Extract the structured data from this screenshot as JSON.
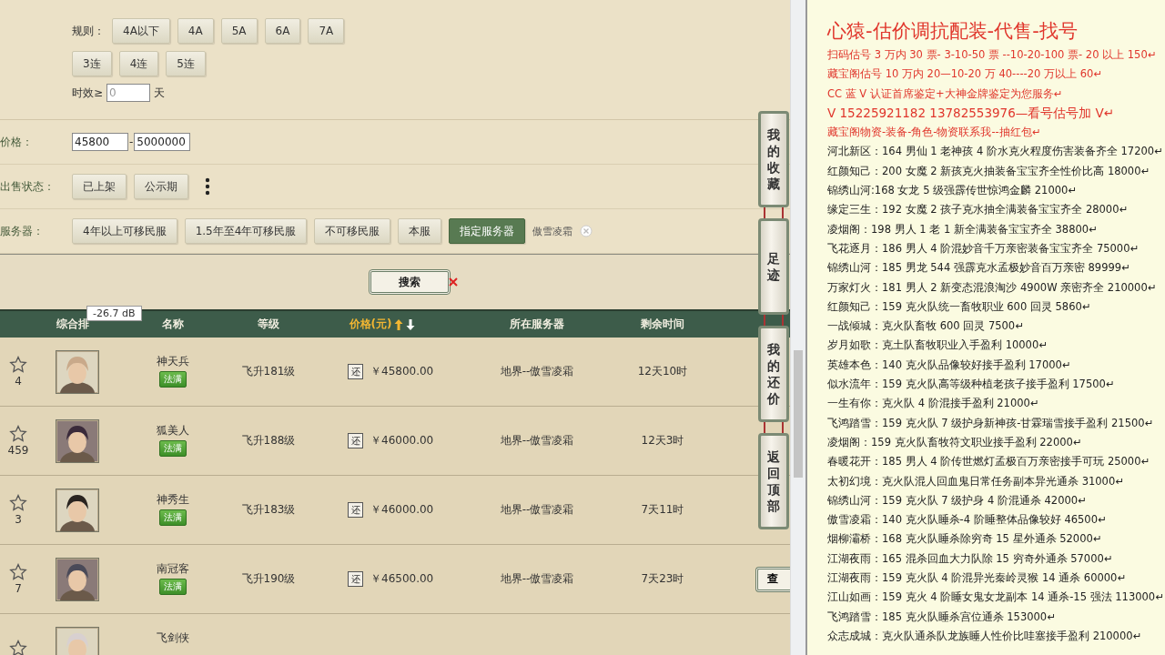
{
  "filters": {
    "rules": {
      "label": "规则：",
      "options": [
        {
          "label": "4A以下",
          "selected": false
        },
        {
          "label": "4A",
          "selected": false
        },
        {
          "label": "5A",
          "selected": false
        },
        {
          "label": "6A",
          "selected": false
        },
        {
          "label": "7A",
          "selected": false
        }
      ]
    },
    "streaks": [
      {
        "label": "3连",
        "selected": false
      },
      {
        "label": "4连",
        "selected": false
      },
      {
        "label": "5连",
        "selected": false
      }
    ],
    "duration": {
      "label": "时效≥",
      "placeholder": "0",
      "unit": "天"
    }
  },
  "price": {
    "label": "价格：",
    "min": "45800",
    "separator": "-",
    "max": "5000000"
  },
  "sale_status": {
    "label": "出售状态：",
    "options": [
      {
        "label": "已上架",
        "selected": false
      },
      {
        "label": "公示期",
        "selected": false
      }
    ]
  },
  "server": {
    "label": "服务器：",
    "options": [
      {
        "label": "4年以上可移民服",
        "selected": false
      },
      {
        "label": "1.5年至4年可移民服",
        "selected": false
      },
      {
        "label": "不可移民服",
        "selected": false
      },
      {
        "label": "本服",
        "selected": false
      },
      {
        "label": "指定服务器",
        "selected": true
      }
    ],
    "chosen": "傲雪凌霜"
  },
  "search_button": "搜索",
  "tooltip": "-26.7 dB",
  "table": {
    "columns": [
      {
        "label": "综合排",
        "sorted": false
      },
      {
        "label": "名称",
        "sorted": false
      },
      {
        "label": "等级",
        "sorted": false
      },
      {
        "label": "价格(元)",
        "sorted": true
      },
      {
        "label": "所在服务器",
        "sorted": false
      },
      {
        "label": "剩余时间",
        "sorted": false
      }
    ],
    "rows": [
      {
        "favorites": "4",
        "name": "神天兵",
        "badge": "法满",
        "level": "飞升181级",
        "bargain": "还",
        "price": "￥45800.00",
        "server": "地界--傲雪凌霜",
        "time": "12天10时"
      },
      {
        "favorites": "459",
        "name": "狐美人",
        "badge": "法满",
        "level": "飞升188级",
        "bargain": "还",
        "price": "￥46000.00",
        "server": "地界--傲雪凌霜",
        "time": "12天3时"
      },
      {
        "favorites": "3",
        "name": "神秀生",
        "badge": "法满",
        "level": "飞升183级",
        "bargain": "还",
        "price": "￥46000.00",
        "server": "地界--傲雪凌霜",
        "time": "7天11时"
      },
      {
        "favorites": "7",
        "name": "南冠客",
        "badge": "法满",
        "level": "飞升190级",
        "bargain": "还",
        "price": "￥46500.00",
        "server": "地界--傲雪凌霜",
        "time": "7天23时",
        "view": "查"
      },
      {
        "name": "飞剑侠"
      }
    ]
  },
  "side_tabs": [
    {
      "label": "我的收藏"
    },
    {
      "label": "足迹"
    },
    {
      "label": "我的还价"
    },
    {
      "label": "返回顶部"
    }
  ],
  "ad": {
    "title": "心猿-估价调抗配装-代售-找号",
    "lines": [
      {
        "kind": "promo",
        "text": "扫码估号 3 万内 30 票- 3-10-50 票  --10-20-100 票- 20 以上 150↵"
      },
      {
        "kind": "promo",
        "text": "藏宝阁估号 10 万内 20—10-20 万 40----20 万以上 60↵"
      },
      {
        "kind": "promo",
        "text": "CC 蓝 V 认证首席鉴定+大神金牌鉴定为您服务↵"
      },
      {
        "kind": "contact",
        "text": "V 15225921182    13782553976—看号估号加 V↵"
      },
      {
        "kind": "promo",
        "text": "藏宝阁物资-装备-角色-物资联系我--抽红包↵"
      },
      {
        "kind": "listing",
        "text": "河北新区：164 男仙 1 老神孩 4 阶水克火程度伤害装备齐全 17200↵"
      },
      {
        "kind": "listing",
        "text": "红颜知己：200 女魔 2 新孩克火抽装备宝宝齐全性价比高 18000↵"
      },
      {
        "kind": "listing",
        "text": "锦绣山河:168 女龙 5 级强霹传世惊鸿金麟 21000↵"
      },
      {
        "kind": "listing",
        "text": "缘定三生：192 女魔 2 孩子克水抽全满装备宝宝齐全 28000↵"
      },
      {
        "kind": "listing",
        "text": "凌烟阁：198 男人 1 老 1 新全满装备宝宝齐全 38800↵"
      },
      {
        "kind": "listing",
        "text": "飞花逐月：186 男人 4 阶混妙音千万亲密装备宝宝齐全 75000↵"
      },
      {
        "kind": "listing",
        "text": "锦绣山河：185 男龙 544 强霹克水孟极妙音百万亲密 89999↵"
      },
      {
        "kind": "listing",
        "text": "万家灯火：181 男人 2 新变态混浪淘沙 4900W 亲密齐全 210000↵"
      },
      {
        "kind": "listing",
        "text": "红颜知己：159 克火队统一畜牧职业 600 回灵 5860↵"
      },
      {
        "kind": "listing",
        "text": "一战倾城：克火队畜牧 600 回灵 7500↵"
      },
      {
        "kind": "listing",
        "text": "岁月如歌：克土队畜牧职业入手盈利 10000↵"
      },
      {
        "kind": "listing",
        "text": "英雄本色：140 克火队品像较好接手盈利 17000↵"
      },
      {
        "kind": "listing",
        "text": "似水流年：159 克火队高等级种植老孩子接手盈利 17500↵"
      },
      {
        "kind": "listing",
        "text": "一生有你：克火队 4 阶混接手盈利 21000↵"
      },
      {
        "kind": "listing",
        "text": "飞鸿踏雪：159 克火队 7 级护身新神孩-甘霖瑞雪接手盈利 21500↵"
      },
      {
        "kind": "listing",
        "text": "凌烟阁：159 克火队畜牧符文职业接手盈利 22000↵"
      },
      {
        "kind": "listing",
        "text": "春暖花开：185 男人 4 阶传世燃灯孟极百万亲密接手可玩 25000↵"
      },
      {
        "kind": "listing",
        "text": "太初幻境：克火队混人回血鬼日常任务副本异光通杀 31000↵"
      },
      {
        "kind": "listing",
        "text": "锦绣山河：159 克火队 7 级护身 4 阶混通杀 42000↵"
      },
      {
        "kind": "listing",
        "text": "傲雪凌霜：140 克火队睡杀-4 阶睡整体品像较好 46500↵"
      },
      {
        "kind": "listing",
        "text": "烟柳灞桥：168 克火队睡杀除穷奇 15 星外通杀 52000↵"
      },
      {
        "kind": "listing",
        "text": "江湖夜雨：165 混杀回血大力队除 15 穷奇外通杀 57000↵"
      },
      {
        "kind": "listing",
        "text": "江湖夜雨：159 克火队 4 阶混异光秦岭灵猴 14 通杀 60000↵"
      },
      {
        "kind": "listing",
        "text": "江山如画：159 克火 4 阶睡女鬼女龙副本 14 通杀-15 强法 113000↵"
      },
      {
        "kind": "listing",
        "text": "飞鸿踏雪：185 克火队睡杀宫位通杀 153000↵"
      },
      {
        "kind": "listing",
        "text": "众志成城：克火队通杀队龙族睡人性价比哇塞接手盈利 210000↵"
      }
    ]
  }
}
